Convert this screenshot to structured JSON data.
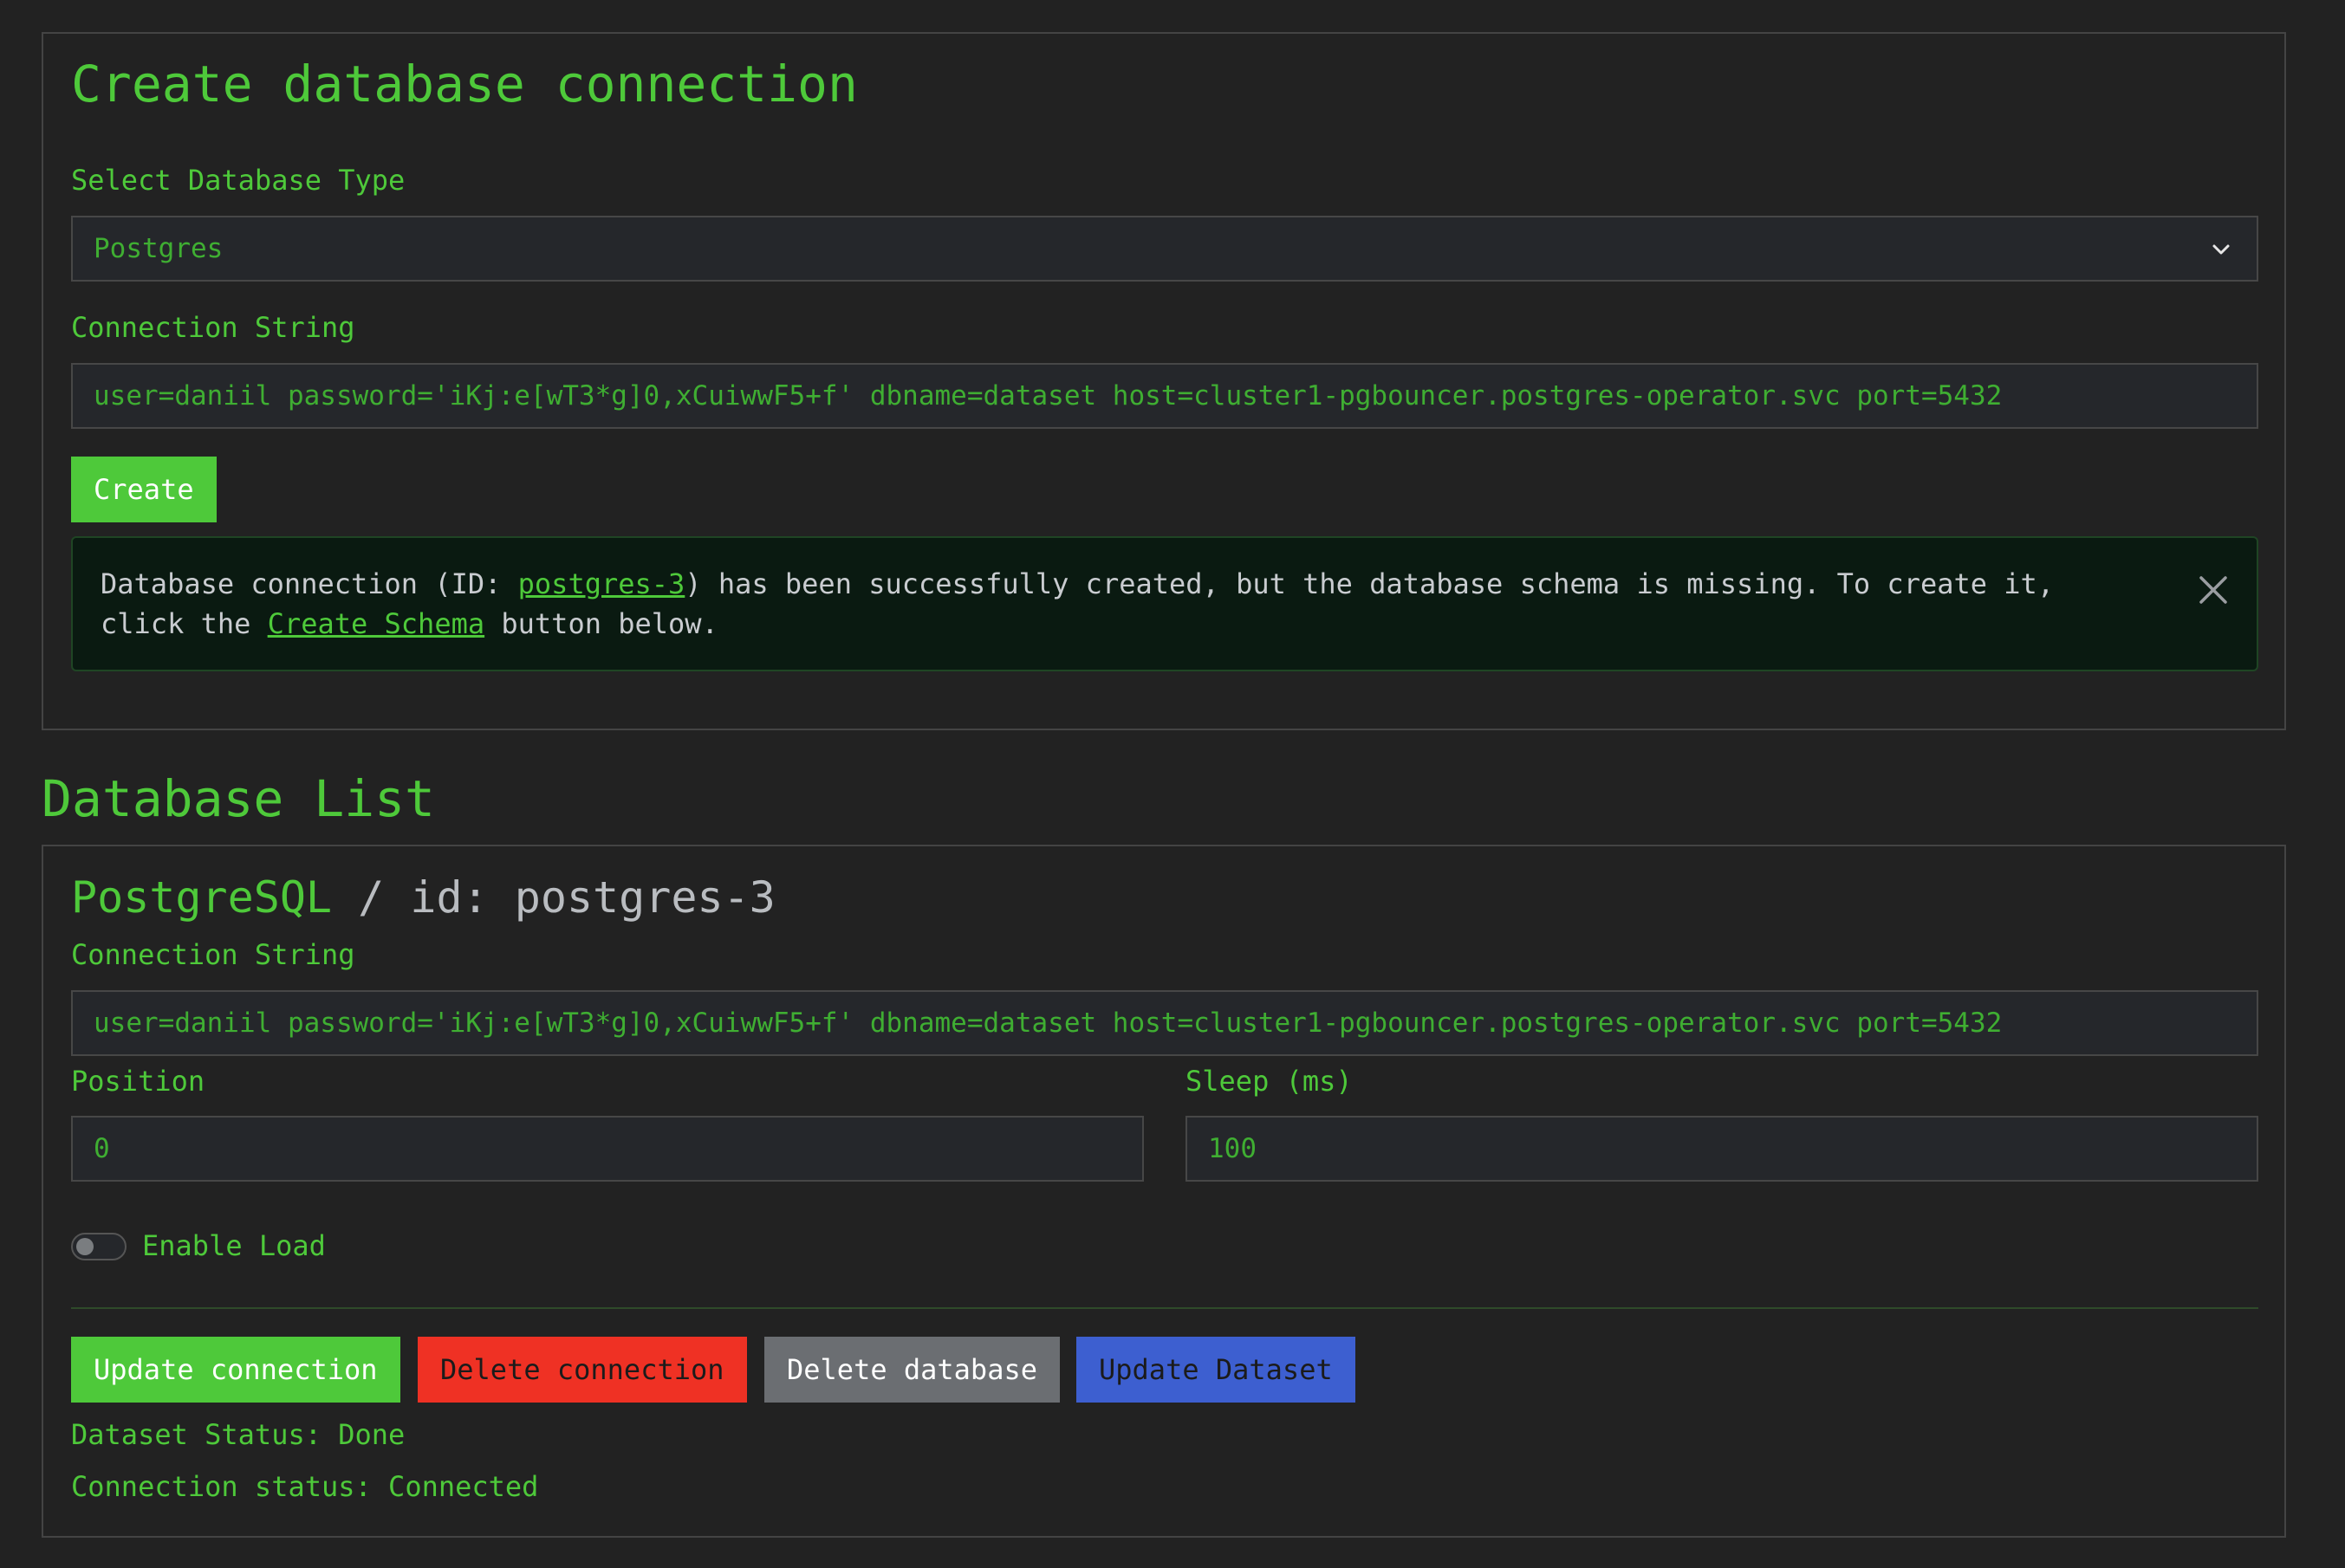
{
  "create_section": {
    "title": "Create database connection",
    "db_type_label": "Select Database Type",
    "db_type_value": "Postgres",
    "conn_string_label": "Connection String",
    "conn_string_value": "user=daniil password='iKj:e[wT3*g]0,xCuiwwF5+f' dbname=dataset host=cluster1-pgbouncer.postgres-operator.svc port=5432",
    "create_label": "Create"
  },
  "alert": {
    "text_before_id": "Database connection (ID: ",
    "id_link": "postgres-3",
    "text_middle": ") has been successfully created, but the database schema is missing. To create it, click the ",
    "schema_link": "Create Schema",
    "text_after": " button below.",
    "close_icon": "close-icon"
  },
  "list_section": {
    "title": "Database List"
  },
  "db_card": {
    "type_name": "PostgreSQL",
    "id_text": " / id: postgres-3",
    "conn_string_label": "Connection String",
    "conn_string_value": "user=daniil password='iKj:e[wT3*g]0,xCuiwwF5+f' dbname=dataset host=cluster1-pgbouncer.postgres-operator.svc port=5432",
    "position_label": "Position",
    "position_value": "0",
    "sleep_label": "Sleep (ms)",
    "sleep_value": "100",
    "enable_load_label": "Enable Load",
    "enable_load_on": false,
    "buttons": {
      "update_connection": "Update connection",
      "delete_connection": "Delete connection",
      "delete_database": "Delete database",
      "update_dataset": "Update Dataset"
    },
    "dataset_status": "Dataset Status: Done",
    "connection_status": "Connection status: Connected"
  },
  "colors": {
    "background": "#222222",
    "accent_green": "#4ec93a",
    "danger_red": "#ef3124",
    "neutral_gray": "#6b6e72",
    "primary_blue": "#3d5fd0"
  }
}
